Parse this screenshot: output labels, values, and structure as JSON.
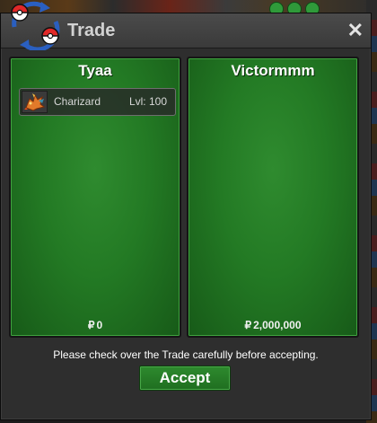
{
  "window": {
    "title": "Trade",
    "close_icon": "close-icon"
  },
  "left_panel": {
    "player_name": "Tyaa",
    "items": [
      {
        "icon": "charizard-sprite-icon",
        "name": "Charizard",
        "level": "Lvl: 100"
      }
    ],
    "money": {
      "currency_symbol": "₽",
      "amount": "0"
    }
  },
  "right_panel": {
    "player_name": "Victormmm",
    "items": [],
    "money": {
      "currency_symbol": "₽",
      "amount": "2,000,000"
    }
  },
  "notice": "Please check over the Trade carefully before accepting.",
  "accept_label": "Accept",
  "colors": {
    "panel_green": "#237a24",
    "button_green": "#2e8a2e",
    "titlebar": "#3a3a3a"
  }
}
